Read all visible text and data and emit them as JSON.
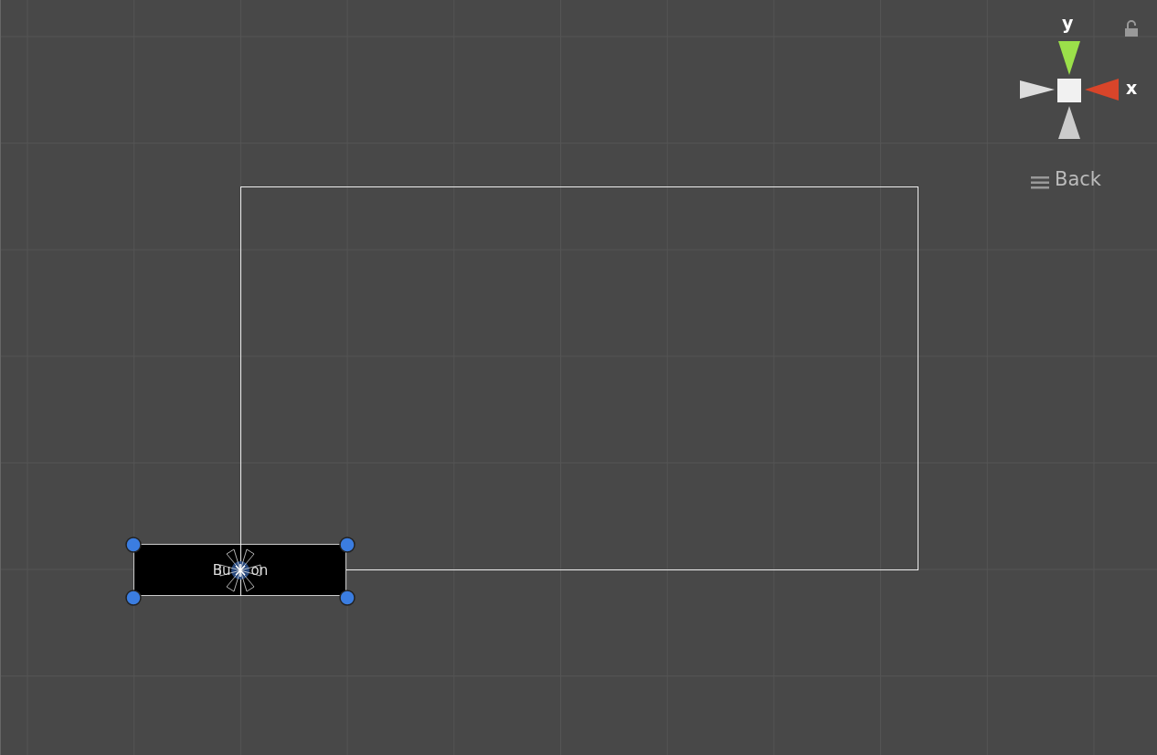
{
  "gizmo": {
    "y_label": "y",
    "x_label": "x",
    "view_label": "Back",
    "locked": false
  },
  "selected_object": {
    "label_parts": [
      "Bu",
      "on"
    ],
    "selected": true
  }
}
